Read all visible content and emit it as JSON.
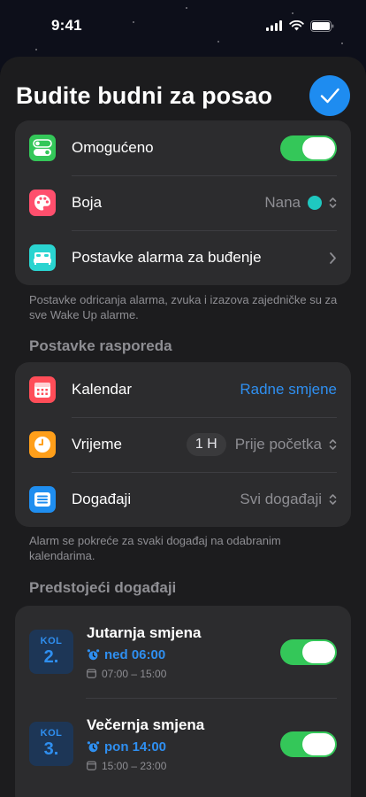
{
  "status": {
    "time": "9:41"
  },
  "header": {
    "title": "Budite budni za posao"
  },
  "settings": {
    "enabled_label": "Omogućeno",
    "color_label": "Boja",
    "color_value": "Nana",
    "color_dot": "#1fc8c0",
    "alarm_settings_label": "Postavke alarma za buđenje"
  },
  "note_alarm": "Postavke odricanja alarma, zvuka i izazova zajedničke su za sve Wake Up alarme.",
  "schedule": {
    "section_title": "Postavke rasporeda",
    "calendar_label": "Kalendar",
    "calendar_value": "Radne smjene",
    "time_label": "Vrijeme",
    "time_pill": "1 H",
    "time_value": "Prije početka",
    "events_label": "Događaji",
    "events_value": "Svi događaji"
  },
  "note_schedule": "Alarm se pokreće za svaki događaj na odabranim kalendarima.",
  "upcoming": {
    "section_title": "Predstojeći događaji",
    "events": [
      {
        "kol": "KOL",
        "week": "2.",
        "title": "Jutarnja smjena",
        "alarm": "ned 06:00",
        "time": "07:00 – 15:00"
      },
      {
        "kol": "KOL",
        "week": "3.",
        "title": "Večernja smjena",
        "alarm": "pon 14:00",
        "time": "15:00 – 23:00"
      }
    ]
  },
  "colors": {
    "accent": "#2f8ff0",
    "toggle_on": "#34c759"
  },
  "icons": [
    "toggle-app-icon",
    "palette-icon",
    "bed-icon",
    "calendar-icon",
    "clock-icon",
    "events-icon",
    "alarm-clock-icon",
    "checkmark-icon"
  ]
}
